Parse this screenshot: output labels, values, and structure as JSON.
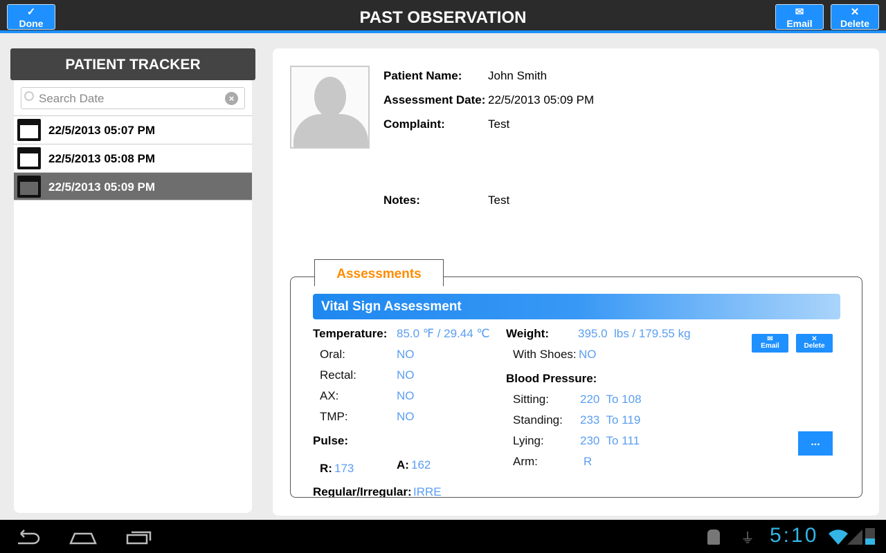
{
  "header": {
    "title": "PAST OBSERVATION",
    "done_label": "Done",
    "email_label": "Email",
    "delete_label": "Delete"
  },
  "sidebar": {
    "title": "PATIENT TRACKER",
    "search_placeholder": "Search Date",
    "items": [
      {
        "label": "22/5/2013 05:07 PM",
        "selected": false
      },
      {
        "label": "22/5/2013 05:08 PM",
        "selected": false
      },
      {
        "label": "22/5/2013 05:09 PM",
        "selected": true
      }
    ]
  },
  "patient": {
    "name_label": "Patient Name:",
    "name": "John Smith",
    "date_label": "Assessment Date:",
    "date": "22/5/2013 05:09 PM",
    "complaint_label": "Complaint:",
    "complaint": "Test",
    "notes_label": "Notes:",
    "notes": "Test"
  },
  "assessments": {
    "tab": "Assessments",
    "section_title": "Vital Sign Assessment",
    "email_label": "Email",
    "delete_label": "Delete",
    "more_label": "...",
    "temperature_label": "Temperature:",
    "temperature": "85.0 ℉ / 29.44 ℃",
    "oral_label": "Oral:",
    "oral": "NO",
    "rectal_label": "Rectal:",
    "rectal": "NO",
    "ax_label": "AX:",
    "ax": "NO",
    "tmp_label": "TMP:",
    "tmp": "NO",
    "pulse_label": "Pulse:",
    "r_label": "R:",
    "r": "173",
    "a_label": "A:",
    "a": "162",
    "regular_label": "Regular/Irregular:",
    "regular": "IRRE",
    "weight_label": "Weight:",
    "weight": "395.0  lbs / 179.55 kg",
    "shoes_label": "With Shoes:",
    "shoes": "NO",
    "bp_label": "Blood Pressure:",
    "sitting_label": "Sitting:",
    "sitting": "220  To 108",
    "standing_label": "Standing:",
    "standing": "233  To 119",
    "lying_label": "Lying:",
    "lying": "230  To 111",
    "arm_label": "Arm:",
    "arm": "R"
  },
  "status_bar": {
    "time": "5:10"
  },
  "colors": {
    "accent": "#1e90ff",
    "value": "#5a9ef0",
    "tab": "#ff8c00"
  }
}
